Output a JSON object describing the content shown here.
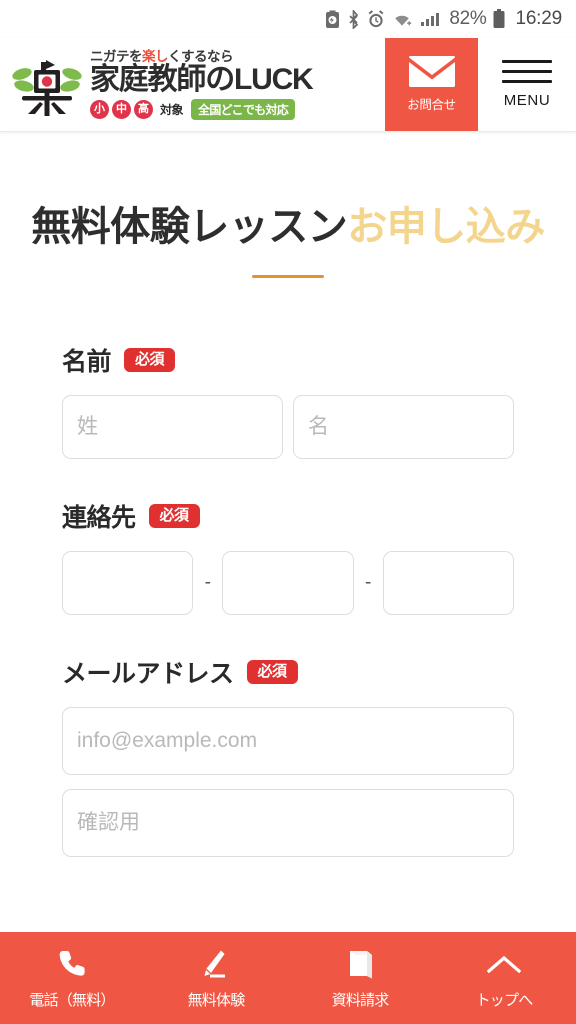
{
  "status_bar": {
    "icons": [
      "battery-saver-icon",
      "bluetooth-icon",
      "alarm-icon",
      "wifi-icon",
      "signal-icon"
    ],
    "battery_percent": "82%",
    "battery_icon": "battery-icon",
    "clock": "16:29"
  },
  "header": {
    "logo": {
      "mark": "raku-kanji-logo",
      "tagline_before": "ニガテを",
      "tagline_highlight": "楽し",
      "tagline_after": "くするなら",
      "name": "家庭教師のLUCK",
      "grades": [
        "小",
        "中",
        "高"
      ],
      "target_label": "対象",
      "coverage_badge": "全国どこでも対応"
    },
    "contact_button": {
      "icon": "mail-icon",
      "label": "お問合せ",
      "color": "#ef5744"
    },
    "menu_button": {
      "icon": "hamburger-icon",
      "label": "MENU"
    }
  },
  "main": {
    "title_primary": "無料体験レッスン",
    "title_accent": "お申し込み",
    "title_accent_color": "#f3d58e",
    "rule_color": "#e8922f",
    "fields": [
      {
        "label": "名前",
        "required_badge": "必須",
        "inputs": [
          {
            "name": "last-name-input",
            "placeholder": "姓",
            "value": ""
          },
          {
            "name": "first-name-input",
            "placeholder": "名",
            "value": ""
          }
        ]
      },
      {
        "label": "連絡先",
        "required_badge": "必須",
        "separator": "-",
        "inputs": [
          {
            "name": "phone-part1-input",
            "placeholder": "",
            "value": ""
          },
          {
            "name": "phone-part2-input",
            "placeholder": "",
            "value": ""
          },
          {
            "name": "phone-part3-input",
            "placeholder": "",
            "value": ""
          }
        ]
      },
      {
        "label": "メールアドレス",
        "required_badge": "必須",
        "inputs": [
          {
            "name": "email-input",
            "placeholder": "info@example.com",
            "value": ""
          },
          {
            "name": "email-confirm-input",
            "placeholder": "確認用",
            "value": ""
          }
        ]
      }
    ]
  },
  "bottom_nav": {
    "background": "#ef5744",
    "items": [
      {
        "icon": "phone-icon",
        "label": "電話（無料）"
      },
      {
        "icon": "pencil-icon",
        "label": "無料体験"
      },
      {
        "icon": "book-icon",
        "label": "資料請求"
      },
      {
        "icon": "chevron-up-icon",
        "label": "トップへ"
      }
    ]
  }
}
